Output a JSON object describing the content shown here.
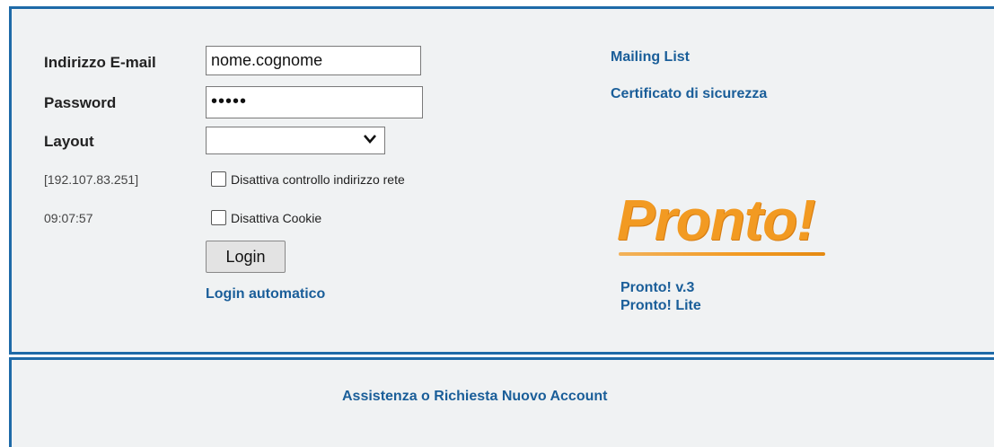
{
  "form": {
    "email_label": "Indirizzo E-mail",
    "email_value": "nome.cognome",
    "password_label": "Password",
    "password_value": "•••••",
    "layout_label": "Layout",
    "layout_value": "",
    "ip_address": "[192.107.83.251]",
    "time": "09:07:57",
    "disable_network_check_label": "Disattiva controllo indirizzo rete",
    "disable_cookie_label": "Disattiva Cookie",
    "login_button": "Login",
    "auto_login_link": "Login automatico"
  },
  "links": {
    "mailing_list": "Mailing List",
    "certificate": "Certificato di sicurezza",
    "pronto_v3": "Pronto! v.3",
    "pronto_lite": "Pronto! Lite"
  },
  "logo": {
    "text": "Pronto!",
    "color": "#f29a22"
  },
  "footer": {
    "support_link": "Assistenza o Richiesta Nuovo Account"
  },
  "colors": {
    "border": "#1e6aa8",
    "link": "#1a5e99",
    "panel_bg": "#f0f2f3"
  }
}
